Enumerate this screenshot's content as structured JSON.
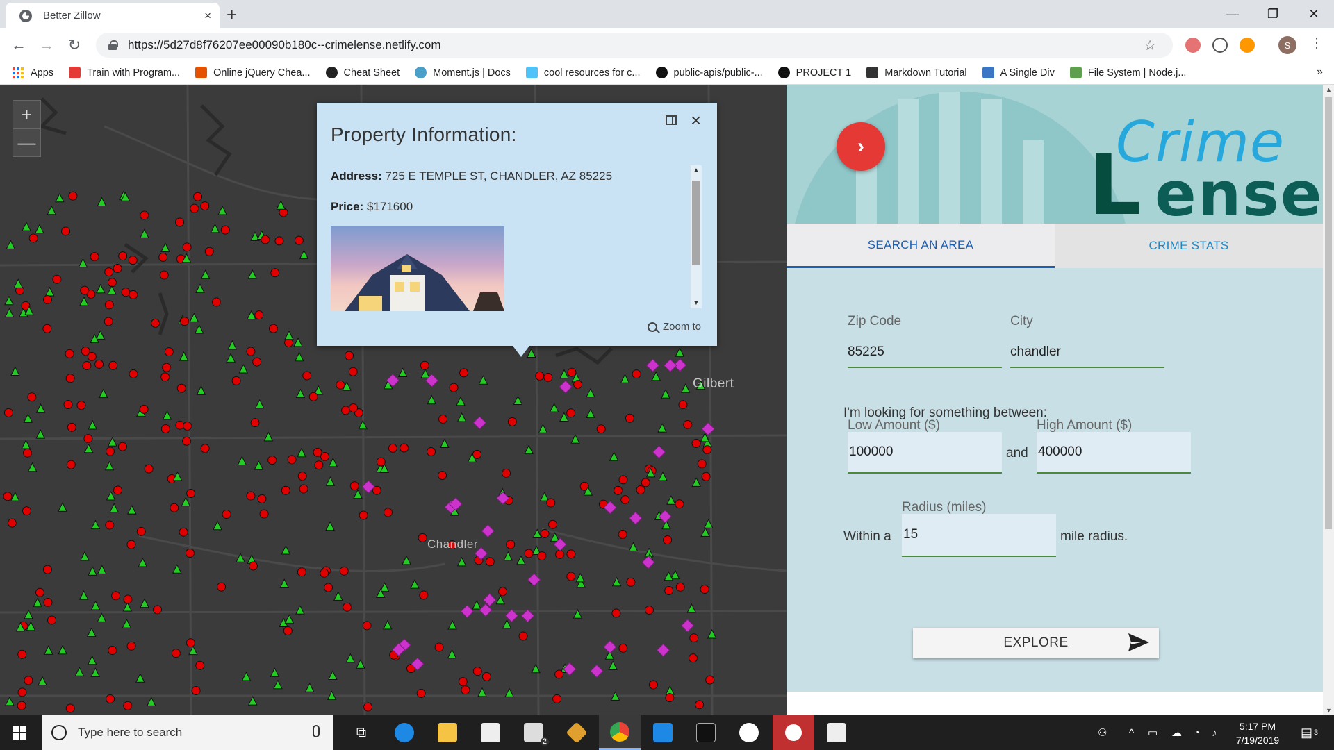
{
  "browser": {
    "tab_title": "Better Zillow",
    "tab_close": "×",
    "new_tab": "+",
    "url": "https://5d27d8f76207ee00090b180c--crimelense.netlify.com",
    "window": {
      "minimize": "—",
      "maximize": "❐",
      "close": "✕"
    },
    "bookmarks": [
      {
        "label": "Apps",
        "icon": "apps-grid-icon",
        "color": ""
      },
      {
        "label": "Train with Program...",
        "icon": "train-icon",
        "color": "#e53935"
      },
      {
        "label": "Online jQuery Chea...",
        "icon": "jquery-icon",
        "color": "#e65100"
      },
      {
        "label": "Cheat Sheet",
        "icon": "cheat-sheet-icon",
        "color": "#222222"
      },
      {
        "label": "Moment.js | Docs",
        "icon": "moment-icon",
        "color": "#4aa0c8"
      },
      {
        "label": "cool resources for c...",
        "icon": "diamond-icon",
        "color": "#4fc3f7"
      },
      {
        "label": "public-apis/public-...",
        "icon": "github-icon",
        "color": "#111111"
      },
      {
        "label": "PROJECT 1",
        "icon": "github-icon",
        "color": "#111111"
      },
      {
        "label": "Markdown Tutorial",
        "icon": "markdown-icon",
        "color": "#333333"
      },
      {
        "label": "A Single Div",
        "icon": "single-div-icon",
        "color": "#3a76c4"
      },
      {
        "label": "File System | Node.j...",
        "icon": "nodejs-icon",
        "color": "#5fa04e"
      }
    ],
    "more": "»"
  },
  "map": {
    "label_gilbert": "Gilbert",
    "label_chandler": "Chandler",
    "zoom_in": "+",
    "zoom_out": "—"
  },
  "popup": {
    "title": "Property Information:",
    "address_label": "Address:",
    "address_value": "725 E TEMPLE ST, CHANDLER, AZ 85225",
    "price_label": "Price:",
    "price_value": "$171600",
    "zoom_to": "Zoom to",
    "close": "×"
  },
  "sidebar": {
    "logo_crime": "Crime",
    "logo_l": "L",
    "logo_ense": "ense",
    "toggle_arrow": "›",
    "tabs": [
      {
        "label": "SEARCH AN AREA"
      },
      {
        "label": "CRIME STATS"
      }
    ],
    "zip_label": "Zip Code",
    "zip_value": "85225",
    "city_label": "City",
    "city_value": "chandler",
    "looking_text": "I'm looking for something between:",
    "low_label": "Low Amount ($)",
    "low_value": "100000",
    "and_text": "and",
    "high_label": "High Amount ($)",
    "high_value": "400000",
    "radius_label": "Radius (miles)",
    "within_text": "Within a",
    "radius_value": "15",
    "mile_text": "mile radius.",
    "explore_label": "EXPLORE"
  },
  "taskbar": {
    "search_placeholder": "Type here to search",
    "time": "5:17 PM",
    "date": "7/19/2019",
    "notification_count": "3",
    "mail_badge": "2"
  },
  "colors": {
    "crime_dot": "#e00000",
    "green_triangle": "#22cc22",
    "property_diamond": "#cc33cc",
    "accent_blue": "#1a5fb4"
  }
}
